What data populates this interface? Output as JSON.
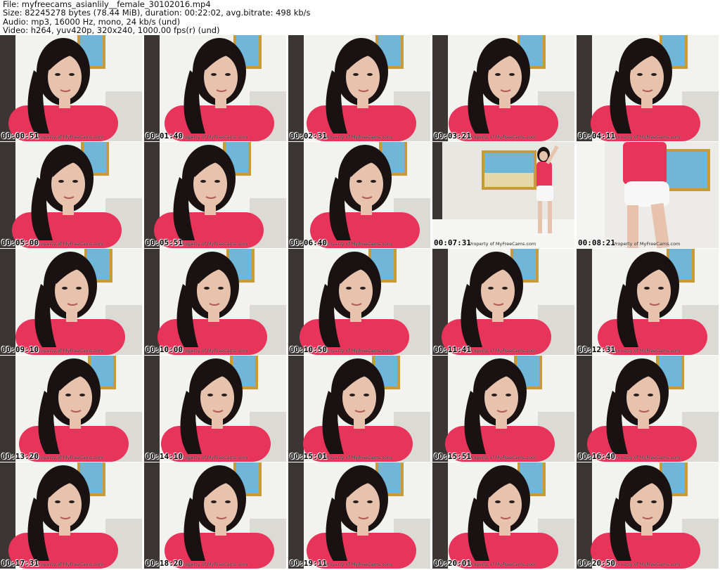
{
  "header": {
    "line1": "File: myfreecams_asianlily__female_30102016.mp4",
    "line2": "Size: 82245278 bytes (78.44 MiB), duration: 00:22:02, avg.bitrate: 498 kb/s",
    "line3": "Audio: mp3, 16000 Hz, mono, 24 kb/s (und)",
    "line4": "Video: h264, yuv420p, 320x240, 1000.00 fps(r) (und)"
  },
  "watermark": "Property of MyFreeCams.com",
  "colors": {
    "shirt": "#e8345a",
    "hair": "#1a1212",
    "skin": "#e7c3ae",
    "wall": "#f2f2ee",
    "frame": "#c79a3a",
    "sea": "#6fb6d8"
  },
  "thumbnails": [
    {
      "time": "00:00:51",
      "scene": "closeup"
    },
    {
      "time": "00:01:40",
      "scene": "closeup"
    },
    {
      "time": "00:02:31",
      "scene": "closeup"
    },
    {
      "time": "00:03:21",
      "scene": "closeup"
    },
    {
      "time": "00:04:11",
      "scene": "closeup"
    },
    {
      "time": "00:05:00",
      "scene": "closeup"
    },
    {
      "time": "00:05:51",
      "scene": "closeup"
    },
    {
      "time": "00:06:40",
      "scene": "closeup"
    },
    {
      "time": "00:07:31",
      "scene": "standing"
    },
    {
      "time": "00:08:21",
      "scene": "legs"
    },
    {
      "time": "00:09:10",
      "scene": "closeup"
    },
    {
      "time": "00:10:00",
      "scene": "closeup"
    },
    {
      "time": "00:10:50",
      "scene": "closeup"
    },
    {
      "time": "00:11:41",
      "scene": "closeup"
    },
    {
      "time": "00:12:31",
      "scene": "closeup"
    },
    {
      "time": "00:13:20",
      "scene": "closeup"
    },
    {
      "time": "00:14:10",
      "scene": "closeup"
    },
    {
      "time": "00:15:01",
      "scene": "closeup"
    },
    {
      "time": "00:15:51",
      "scene": "closeup"
    },
    {
      "time": "00:16:40",
      "scene": "closeup"
    },
    {
      "time": "00:17:31",
      "scene": "closeup"
    },
    {
      "time": "00:18:20",
      "scene": "closeup"
    },
    {
      "time": "00:19:11",
      "scene": "closeup"
    },
    {
      "time": "00:20:01",
      "scene": "closeup"
    },
    {
      "time": "00:20:50",
      "scene": "closeup"
    }
  ]
}
